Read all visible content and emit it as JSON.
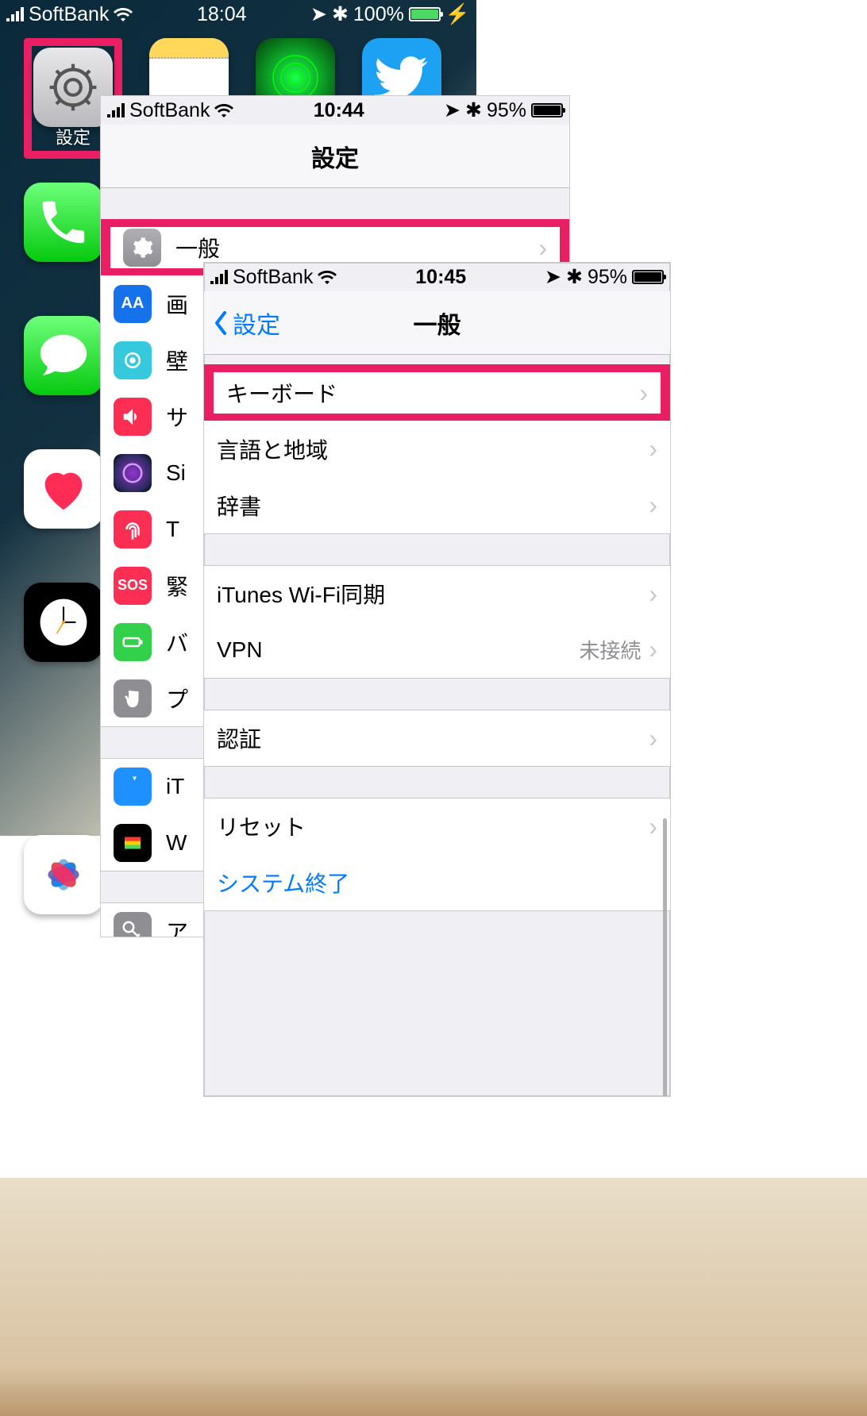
{
  "home": {
    "statusbar": {
      "carrier": "SoftBank",
      "time": "18:04",
      "battery_pct": "100%"
    },
    "apps": {
      "settings": "設定",
      "phone": "電話",
      "messages": "メッセー",
      "health": "ヘルスケ",
      "clock": "時計"
    }
  },
  "settings": {
    "statusbar": {
      "carrier": "SoftBank",
      "time": "10:44",
      "battery_pct": "95%"
    },
    "title": "設定",
    "items": {
      "general": "一般",
      "display": "画",
      "wallpaper": "壁",
      "sound": "サ",
      "siri": "Si",
      "touchid": "T",
      "emergency": "緊",
      "battery": "バ",
      "privacy": "プ",
      "itunes": "iT",
      "wallet": "W",
      "passwords": "ア"
    }
  },
  "general": {
    "statusbar": {
      "carrier": "SoftBank",
      "time": "10:45",
      "battery_pct": "95%"
    },
    "back": "設定",
    "title": "一般",
    "items": {
      "keyboard": "キーボード",
      "language": "言語と地域",
      "dictionary": "辞書",
      "itunes_wifi": "iTunes Wi-Fi同期",
      "vpn": "VPN",
      "vpn_status": "未接続",
      "auth": "認証",
      "reset": "リセット",
      "shutdown": "システム終了"
    }
  }
}
